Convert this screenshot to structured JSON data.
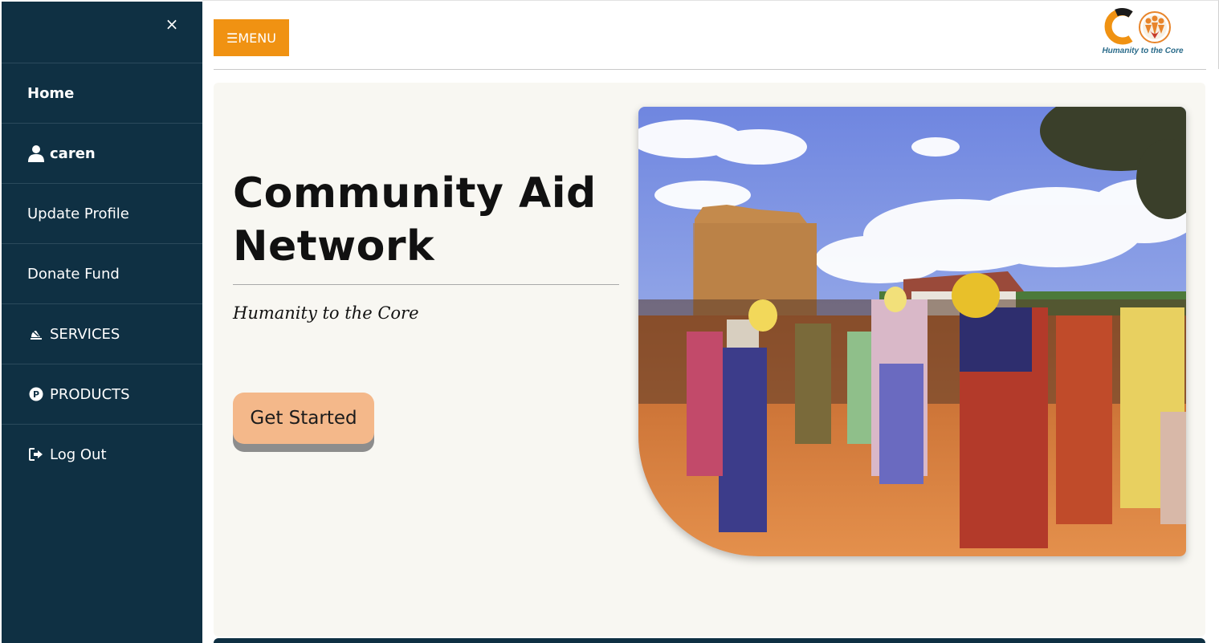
{
  "sidebar": {
    "close_label": "×",
    "items": [
      {
        "label": "Home",
        "icon": ""
      },
      {
        "label": "caren",
        "icon": "user-icon"
      },
      {
        "label": "Update Profile",
        "icon": ""
      },
      {
        "label": "Donate Fund",
        "icon": ""
      },
      {
        "label": "SERVICES",
        "icon": "service-bell-icon"
      },
      {
        "label": "PRODUCTS",
        "icon": "product-p-icon"
      },
      {
        "label": "Log Out",
        "icon": "logout-icon"
      }
    ]
  },
  "header": {
    "menu_label": "☰MENU",
    "logo_tagline": "Humanity to the Core"
  },
  "hero": {
    "title": "Community Aid Network",
    "tagline": "Humanity to the Core",
    "cta_label": "Get Started"
  },
  "colors": {
    "sidebar_bg": "#0f3043",
    "menu_button": "#f09212",
    "cta_button": "#f4b88a",
    "hero_bg": "#f8f7f2"
  }
}
